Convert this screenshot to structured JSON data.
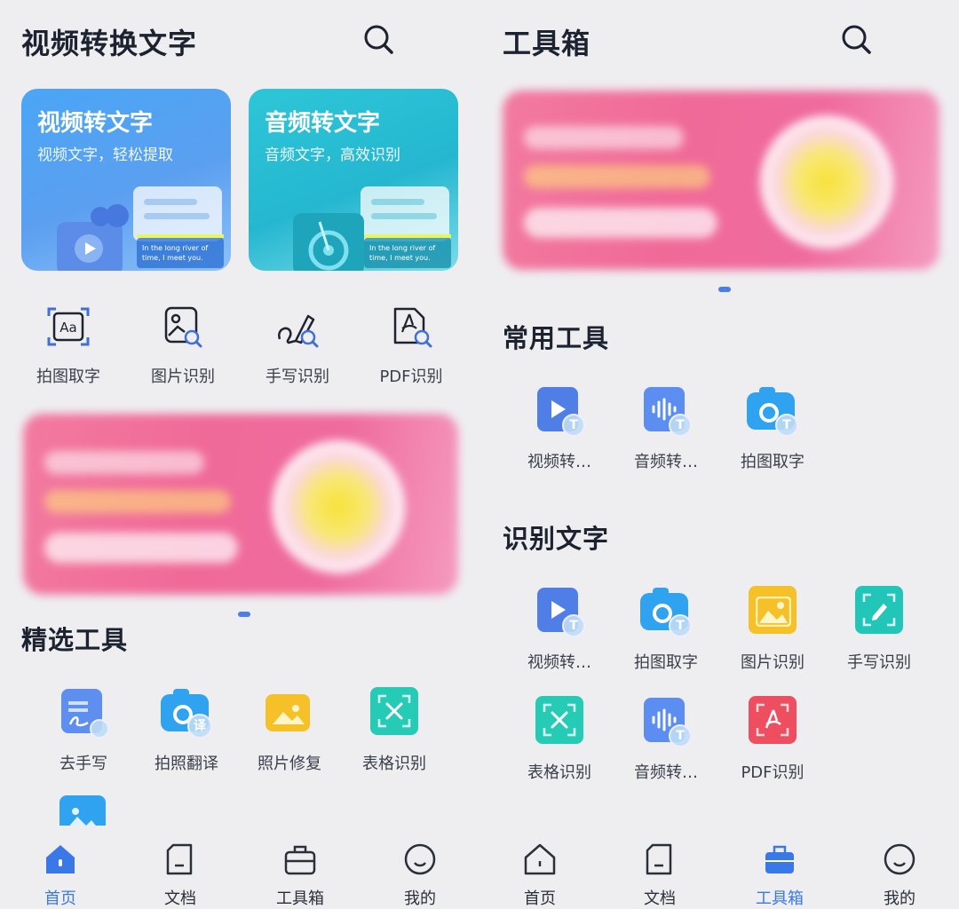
{
  "left": {
    "title": "视频转换文字",
    "cards": [
      {
        "title": "视频转文字",
        "subtitle": "视频文字，轻松提取",
        "caption": "In the long river of time, I meet you."
      },
      {
        "title": "音频转文字",
        "subtitle": "音频文字，高效识别",
        "caption": "In the long river of time, I meet you."
      }
    ],
    "quick_tools": [
      {
        "label": "拍图取字",
        "icon": "text-scan-icon"
      },
      {
        "label": "图片识别",
        "icon": "image-search-icon"
      },
      {
        "label": "手写识别",
        "icon": "handwriting-search-icon"
      },
      {
        "label": "PDF识别",
        "icon": "pdf-search-icon"
      }
    ],
    "section_title": "精选工具",
    "featured_tools": [
      {
        "label": "去手写",
        "icon": "remove-handwriting-icon"
      },
      {
        "label": "拍照翻译",
        "icon": "camera-translate-icon",
        "badge": "译"
      },
      {
        "label": "照片修复",
        "icon": "photo-restore-icon"
      },
      {
        "label": "表格识别",
        "icon": "table-recognize-icon"
      }
    ]
  },
  "right": {
    "title": "工具箱",
    "sections": [
      {
        "title": "常用工具",
        "tools": [
          {
            "label": "视频转…",
            "icon": "video-to-text-icon"
          },
          {
            "label": "音频转…",
            "icon": "audio-to-text-icon"
          },
          {
            "label": "拍图取字",
            "icon": "camera-text-icon"
          }
        ]
      },
      {
        "title": "识别文字",
        "tools": [
          {
            "label": "视频转…",
            "icon": "video-to-text-icon"
          },
          {
            "label": "拍图取字",
            "icon": "camera-text-icon"
          },
          {
            "label": "图片识别",
            "icon": "image-recognize-icon"
          },
          {
            "label": "手写识别",
            "icon": "handwriting-icon"
          },
          {
            "label": "表格识别",
            "icon": "table-recognize-icon"
          },
          {
            "label": "音频转…",
            "icon": "audio-to-text-icon"
          },
          {
            "label": "PDF识别",
            "icon": "pdf-recognize-icon"
          }
        ]
      }
    ]
  },
  "tabbar_left": {
    "active": "home",
    "items": [
      "首页",
      "文档",
      "工具箱",
      "我的"
    ]
  },
  "tabbar_right": {
    "active": "toolbox",
    "items": [
      "首页",
      "文档",
      "工具箱",
      "我的"
    ]
  },
  "colors": {
    "accent": "#3b78e7",
    "video_tile": "#4f7fe6",
    "audio_tile": "#5b8ef0",
    "camera_tile": "#2fa3ef",
    "image_tile": "#f5c028",
    "handwriting_tile": "#22c6b8",
    "table_tile": "#25cbb5",
    "pdf_tile": "#ee4e5f"
  }
}
